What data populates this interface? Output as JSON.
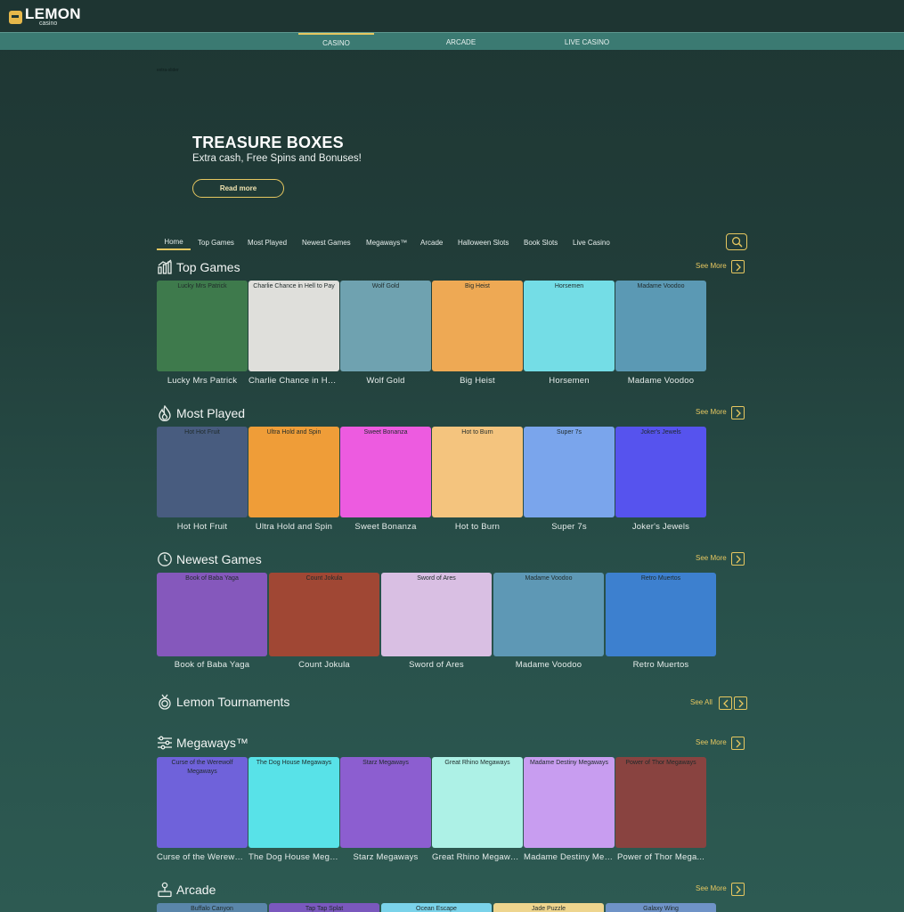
{
  "brand": {
    "name": "LEMON",
    "sub": "casino",
    "accent": "#e6c760"
  },
  "top_tabs": [
    {
      "label": "CASINO",
      "active": true
    },
    {
      "label": "ARCADE",
      "active": false
    },
    {
      "label": "LIVE CASINO",
      "active": false
    }
  ],
  "tiny_label": "extra-slider",
  "hero": {
    "title": "TREASURE BOXES",
    "subtitle": "Extra cash, Free Spins and Bonuses!",
    "button": "Read more"
  },
  "nav": [
    {
      "label": "Home",
      "active": true
    },
    {
      "label": "Top Games"
    },
    {
      "label": "Most Played"
    },
    {
      "label": "Newest Games"
    },
    {
      "label": "Megaways™"
    },
    {
      "label": "Arcade"
    },
    {
      "label": "Halloween Slots"
    },
    {
      "label": "Book Slots"
    },
    {
      "label": "Live Casino"
    }
  ],
  "search_icon": "search-icon",
  "sections": {
    "top_games": {
      "title": "Top Games",
      "icon": "bar-chart-icon",
      "see_more": "See More",
      "games": [
        {
          "name": "Lucky Mrs Patrick",
          "color": "#3e7a4c"
        },
        {
          "name": "Charlie Chance in Hell to Pay",
          "short": "Charlie Chance in Hel...",
          "color": "#dfdfdb"
        },
        {
          "name": "Wolf Gold",
          "color": "#6fa2b0"
        },
        {
          "name": "Big Heist",
          "color": "#eea954"
        },
        {
          "name": "Horsemen",
          "color": "#74dde6"
        },
        {
          "name": "Madame Voodoo",
          "color": "#5b99b4"
        }
      ]
    },
    "most_played": {
      "title": "Most Played",
      "icon": "flame-icon",
      "see_more": "See More",
      "games": [
        {
          "name": "Hot Hot Fruit",
          "color": "#485c7f"
        },
        {
          "name": "Ultra Hold and Spin",
          "color": "#ef9d38"
        },
        {
          "name": "Sweet Bonanza",
          "color": "#ed5be0"
        },
        {
          "name": "Hot to Burn",
          "color": "#f4c47e"
        },
        {
          "name": "Super 7s",
          "color": "#7aa5ec"
        },
        {
          "name": "Joker's Jewels",
          "color": "#5653ee"
        }
      ]
    },
    "newest_games": {
      "title": "Newest Games",
      "icon": "clock-icon",
      "see_more": "See More",
      "games": [
        {
          "name": "Book of Baba Yaga",
          "color": "#8558bc"
        },
        {
          "name": "Count Jokula",
          "color": "#a04734"
        },
        {
          "name": "Sword of Ares",
          "color": "#d9bfe3"
        },
        {
          "name": "Madame Voodoo",
          "color": "#5e98b5"
        },
        {
          "name": "Retro Muertos",
          "color": "#3d80cf"
        }
      ]
    },
    "tournaments": {
      "title": "Lemon Tournaments",
      "icon": "medal-icon",
      "see_all": "See All"
    },
    "megaways": {
      "title": "Megaways™",
      "icon": "sliders-icon",
      "see_more": "See More",
      "games": [
        {
          "name": "Curse of the Werewolf Megaways",
          "short": "Curse of the Werewol...",
          "color": "#6f62da"
        },
        {
          "name": "The Dog House Megaways",
          "short": "The Dog House Mega...",
          "color": "#58e2e8"
        },
        {
          "name": "Starz Megaways",
          "color": "#8c5ed0"
        },
        {
          "name": "Great Rhino Megaways",
          "color": "#adf1e6"
        },
        {
          "name": "Madame Destiny Megaways",
          "short": "Madame Destiny Meg...",
          "color": "#c89df0"
        },
        {
          "name": "Power of Thor Megaways",
          "short": "Power of Thor Mega...",
          "color": "#894340"
        }
      ]
    },
    "arcade": {
      "title": "Arcade",
      "icon": "joystick-icon",
      "see_more": "See More",
      "games": [
        {
          "name": "Buffalo Canyon",
          "color": "#5a86aa"
        },
        {
          "name": "Tap Tap Splat",
          "color": "#7a58be"
        },
        {
          "name": "Ocean Escape",
          "color": "#7ad3ea"
        },
        {
          "name": "Jade Puzzle",
          "color": "#eed58e"
        },
        {
          "name": "Galaxy Wing",
          "color": "#6f93c7"
        }
      ]
    }
  }
}
